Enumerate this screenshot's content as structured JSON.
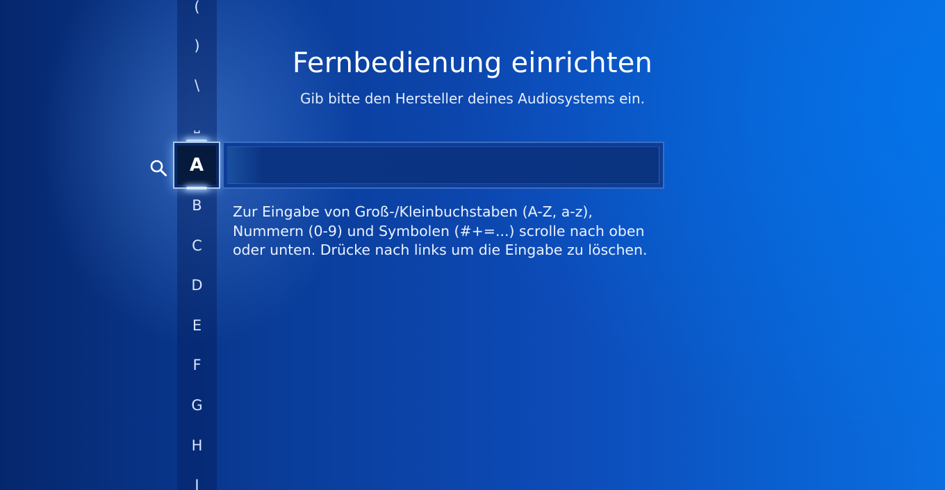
{
  "header": {
    "title": "Fernbedienung einrichten",
    "subtitle": "Gib bitte den Hersteller deines Audiosystems ein."
  },
  "input": {
    "value": ""
  },
  "help": {
    "lines": [
      "Zur Eingabe von Groß-/Kleinbuchstaben (A-Z, a-z),",
      "Nummern (0-9) und Symbolen (#+=...) scrolle nach oben",
      "oder unten. Drücke nach links um die Eingabe zu löschen."
    ]
  },
  "picker": {
    "above": [
      "(",
      ")",
      "\\",
      "⎵"
    ],
    "selected": "A",
    "below": [
      "B",
      "C",
      "D",
      "E",
      "F",
      "G",
      "H",
      "I"
    ]
  },
  "icons": {
    "search": "search-icon"
  }
}
